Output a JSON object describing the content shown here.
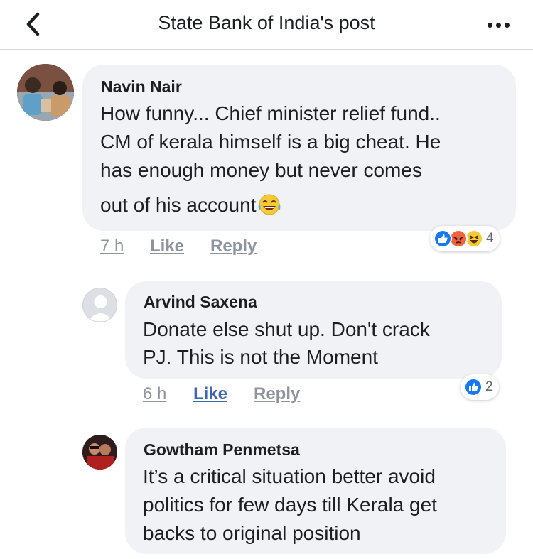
{
  "header": {
    "title": "State Bank of India's post"
  },
  "comments": [
    {
      "author": "Navin Nair",
      "lines": [
        "How funny... Chief minister relief fund..",
        "CM of kerala himself is a big cheat. He",
        "has enough money but never comes",
        "out of his account"
      ],
      "time": "7 h",
      "like": "Like",
      "reply": "Reply",
      "reaction_count": "4"
    },
    {
      "author": "Arvind Saxena",
      "lines": [
        "Donate else shut up.  Don't crack",
        "PJ. This is not the Moment"
      ],
      "time": "6 h",
      "like": "Like",
      "reply": "Reply",
      "reaction_count": "2"
    },
    {
      "author": "Gowtham Penmetsa",
      "lines": [
        "It’s a critical situation better avoid",
        "politics for few days till Kerala get",
        "backs to original position"
      ]
    }
  ],
  "colors": {
    "like_blue": "#4267b2",
    "bubble_grey": "#f0f2f5",
    "reaction_blue": "#1877f2",
    "angry_red": "#f0633c",
    "haha_yellow": "#f7c937"
  }
}
